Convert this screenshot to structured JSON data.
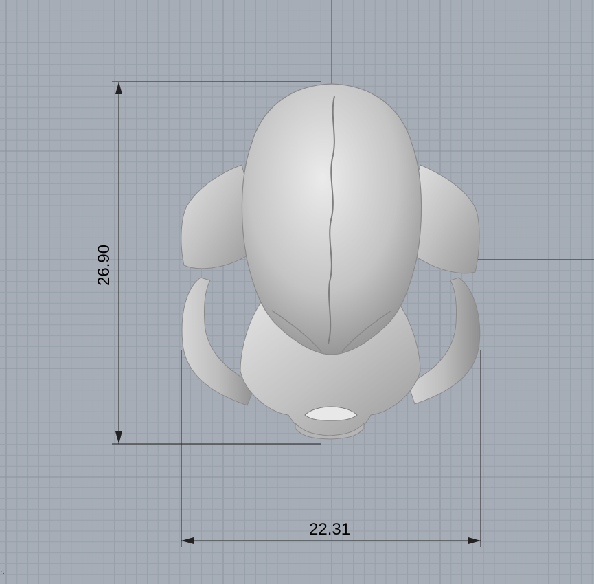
{
  "viewport": {
    "background": "#a6adb6",
    "grid_minor_color": "#98a0aa",
    "grid_major_color": "#8c949e",
    "x_axis_color": "#b02020",
    "y_axis_color": "#20a020"
  },
  "model": {
    "name": "skull-model",
    "color": "#c9c9c9"
  },
  "dimensions": {
    "width_label": "22.31",
    "height_label": "26.90"
  },
  "corner_glyph": "·:"
}
